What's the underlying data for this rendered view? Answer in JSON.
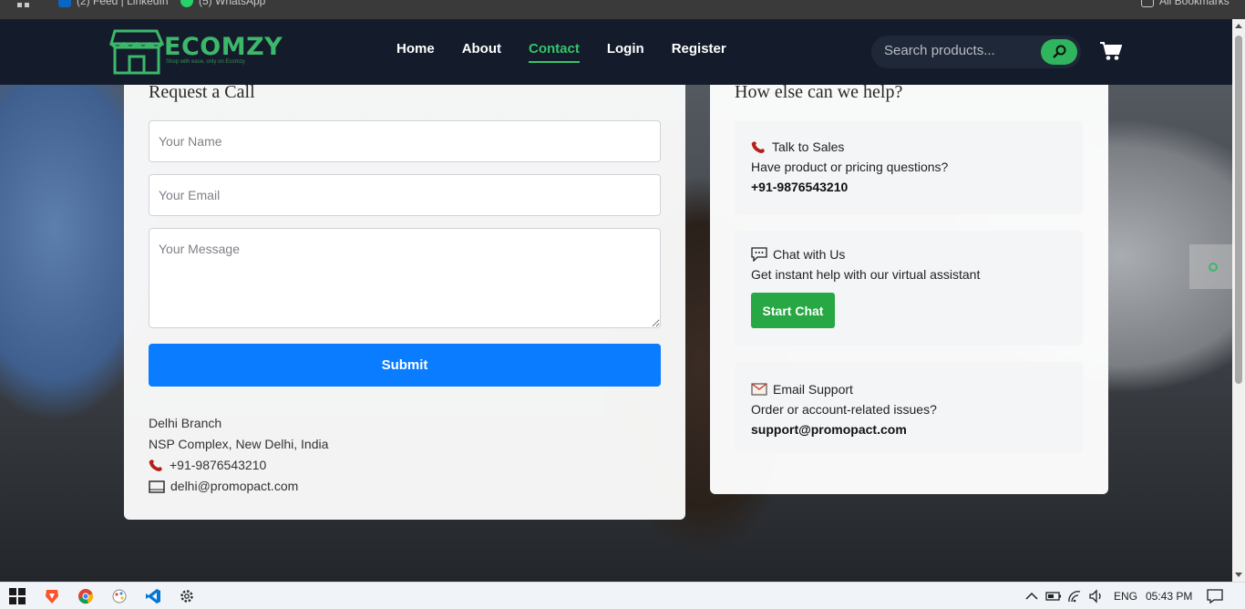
{
  "bookmarks": [
    {
      "label": "(2) Feed | LinkedIn",
      "color": "#0a66c2",
      "icon": "linkedin-icon"
    },
    {
      "label": "(5) WhatsApp",
      "color": "#25d366",
      "icon": "whatsapp-icon"
    },
    {
      "label": "All Bookmarks",
      "icon": "folder-icon"
    }
  ],
  "brand": {
    "name": "ECOMZY",
    "tagline": "Shop with ease, only on Ecomzy",
    "accent": "#36c46a"
  },
  "nav": {
    "items": [
      "Home",
      "About",
      "Contact",
      "Login",
      "Register"
    ],
    "active": "Contact"
  },
  "search": {
    "placeholder": "Search products..."
  },
  "request_call": {
    "title": "Request a Call",
    "name_placeholder": "Your Name",
    "email_placeholder": "Your Email",
    "message_placeholder": "Your Message",
    "submit_label": "Submit",
    "submit_color": "#0a7cff",
    "branch": {
      "name": "Delhi Branch",
      "address": "NSP Complex, New Delhi, India",
      "phone": "+91-9876543210",
      "email": "delhi@promopact.com"
    }
  },
  "help": {
    "title": "How else can we help?",
    "sales": {
      "title": "Talk to Sales",
      "desc": "Have product or pricing questions?",
      "phone": "+91-9876543210"
    },
    "chat": {
      "title": "Chat with Us",
      "desc": "Get instant help with our virtual assistant",
      "button": "Start Chat",
      "button_color": "#28a745"
    },
    "email": {
      "title": "Email Support",
      "desc": "Order or account-related issues?",
      "address": "support@promopact.com"
    }
  },
  "taskbar": {
    "language": "ENG",
    "time": "05:43 PM"
  }
}
